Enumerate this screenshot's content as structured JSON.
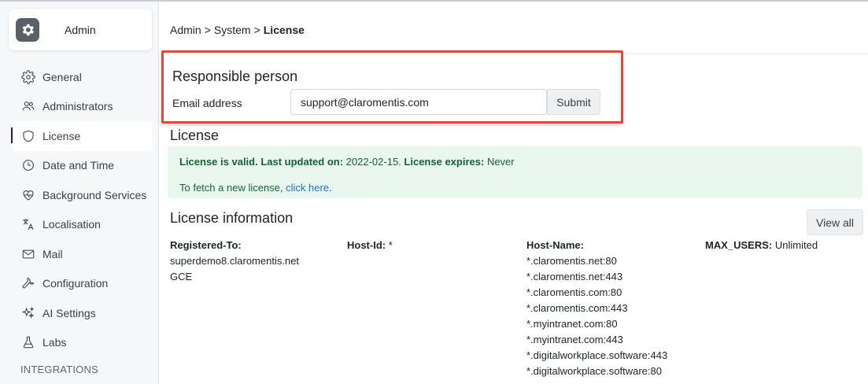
{
  "sidebar": {
    "brand": "Admin",
    "items": [
      {
        "label": "General",
        "icon": "gear-icon"
      },
      {
        "label": "Administrators",
        "icon": "users-icon"
      },
      {
        "label": "License",
        "icon": "shield-icon",
        "active": true
      },
      {
        "label": "Date and Time",
        "icon": "clock-icon"
      },
      {
        "label": "Background Services",
        "icon": "heartbeat-icon"
      },
      {
        "label": "Localisation",
        "icon": "translate-icon"
      },
      {
        "label": "Mail",
        "icon": "mail-icon"
      },
      {
        "label": "Configuration",
        "icon": "wrench-icon"
      },
      {
        "label": "AI Settings",
        "icon": "sparkles-icon"
      },
      {
        "label": "Labs",
        "icon": "flask-icon"
      }
    ],
    "section": "INTEGRATIONS"
  },
  "breadcrumb": {
    "parts": [
      "Admin",
      "System",
      "License"
    ],
    "separator": ">"
  },
  "responsible": {
    "heading": "Responsible person",
    "email_label": "Email address",
    "email_value": "support@claromentis.com",
    "submit_label": "Submit"
  },
  "license": {
    "heading": "License",
    "valid_text": "License is valid. Last updated on:",
    "updated": "2022-02-15.",
    "expires_label": "License expires:",
    "expires": "Never",
    "fetch_text": "To fetch a new license,",
    "fetch_link": "click here",
    "fetch_end": "."
  },
  "info": {
    "heading": "License information",
    "view_all": "View all",
    "registered_label": "Registered-To:",
    "registered_lines": [
      "superdemo8.claromentis.net",
      "GCE"
    ],
    "host_id_label": "Host-Id:",
    "host_id": "*",
    "host_name_label": "Host-Name:",
    "host_names": [
      "*.claromentis.net:80",
      "*.claromentis.net:443",
      "*.claromentis.com:80",
      "*.claromentis.com:443",
      "*.myintranet.com:80",
      "*.myintranet.com:443",
      "*.digitalworkplace.software:443",
      "*.digitalworkplace.software:80"
    ],
    "max_users_label": "MAX_USERS:",
    "max_users": "Unlimited"
  },
  "colors": {
    "highlight": "#e04b40",
    "alert_bg": "#e9f7ee",
    "alert_text": "#18603a",
    "link": "#1f6fd1"
  }
}
